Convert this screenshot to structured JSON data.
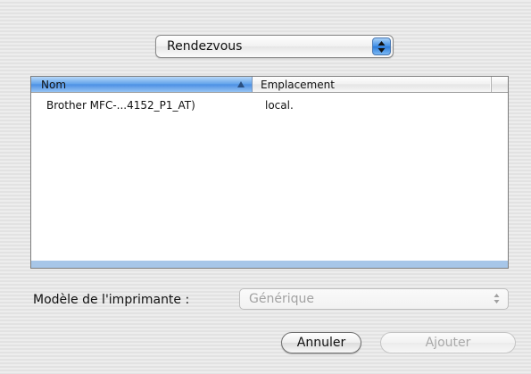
{
  "source_popup": {
    "selected": "Rendezvous"
  },
  "printer_list": {
    "columns": [
      "Nom",
      "Emplacement"
    ],
    "rows": [
      {
        "name": "Brother MFC-...4152_P1_AT)",
        "location": "local."
      }
    ]
  },
  "model": {
    "label": "Modèle de l'imprimante :",
    "value": "Générique"
  },
  "buttons": {
    "cancel": "Annuler",
    "add": "Ajouter"
  },
  "icons": {
    "popup_stepper": "up-down-arrows-icon",
    "sort_indicator": "sort-ascending-icon",
    "model_stepper": "up-down-arrows-icon"
  },
  "colors": {
    "accent": "#4a8fe3",
    "selection_tint": "#a7c6e8"
  }
}
